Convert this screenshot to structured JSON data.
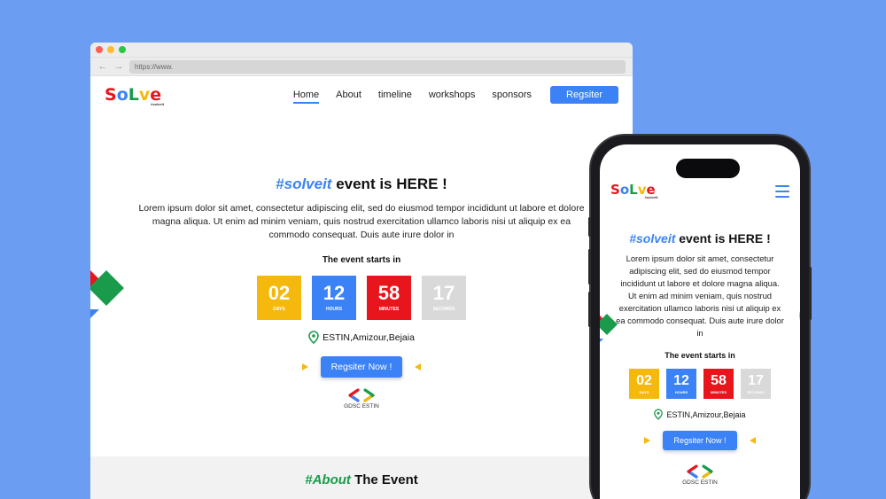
{
  "browser": {
    "url": "https://www."
  },
  "site": {
    "logo_letters": [
      "S",
      "o",
      "L",
      "v",
      "e"
    ],
    "logo_colors": [
      "#e8151c",
      "#3b82f6",
      "#1a9b4b",
      "#f5b90d",
      "#e8151c"
    ],
    "logo_tag": "#solveit",
    "nav": {
      "items": [
        "Home",
        "About",
        "timeline",
        "workshops",
        "sponsors"
      ],
      "active": "Home",
      "register_label": "Regsiter"
    },
    "hero": {
      "hashtag": "#solveit",
      "headline_rest": " event is HERE !",
      "lorem": "Lorem ipsum dolor sit amet, consectetur adipiscing elit, sed do eiusmod tempor incididunt ut labore et dolore magna aliqua. Ut enim ad minim veniam, quis nostrud exercitation ullamco laboris nisi ut aliquip ex ea commodo consequat. Duis aute irure dolor in",
      "starts_label": "The event starts in",
      "countdown": [
        {
          "value": "02",
          "unit": "DAYS",
          "color": "#f5b90d"
        },
        {
          "value": "12",
          "unit": "HOURS",
          "color": "#3b82f6"
        },
        {
          "value": "58",
          "unit": "MINUTES",
          "color": "#e8151c"
        },
        {
          "value": "17",
          "unit": "SECONDS",
          "color": "#d9d9d9"
        }
      ],
      "location": "ESTIN,Amizour,Bejaia",
      "cta_label": "Regsiter Now !",
      "org_label": "GDSC ESTIN"
    },
    "about": {
      "hashtag": "#About",
      "title_rest": " The Event"
    }
  },
  "colors": {
    "background": "#6b9ef2",
    "accent_blue": "#3b82f6",
    "accent_green": "#1a9b4b",
    "accent_yellow": "#f5b90d",
    "accent_red": "#e8151c"
  }
}
